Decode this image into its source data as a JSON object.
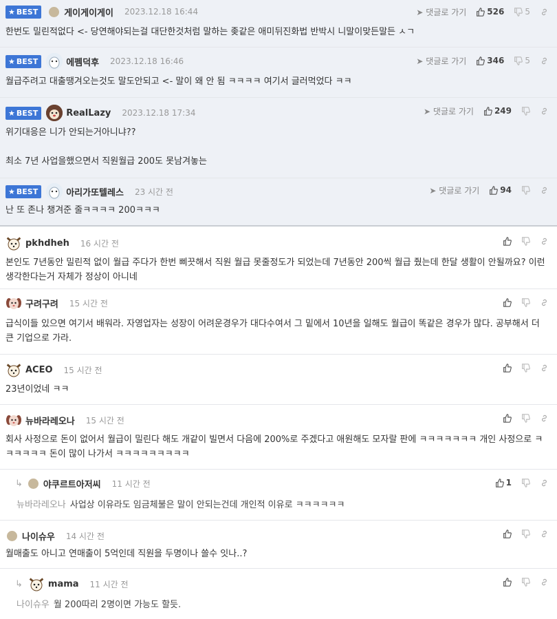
{
  "labels": {
    "best": "BEST",
    "reply_go": "댓글로 가기"
  },
  "comments": [
    {
      "nick": "게이게이게이",
      "time": "2023.12.18 16:44",
      "up": "526",
      "down": "5",
      "text": "한번도 밀린적없다 <- 당연해야되는걸 대단한것처럼 말하는 좆같은 애미뒤진화법 반박시 니말이맞든말든 ㅅㄱ"
    },
    {
      "nick": "에펨덕후",
      "time": "2023.12.18 16:46",
      "up": "346",
      "down": "5",
      "text": "월급주려고 대출땡겨오는것도 말도안되고 <- 말이 왜 안 됨 ㅋㅋㅋㅋ 여기서 글러먹었다 ㅋㅋ"
    },
    {
      "nick": "RealLazy",
      "time": "2023.12.18 17:34",
      "up": "249",
      "down": "",
      "text": "위기대응은 니가 안되는거아니냐??\n\n최소 7년 사업을했으면서 직원월급 200도 못남겨놓는"
    },
    {
      "nick": "아리가또텔레스",
      "time": "23 시간 전",
      "up": "94",
      "down": "",
      "text": "난 또 존나 챙겨준 줄ㅋㅋㅋㅋ 200ㅋㅋㅋ"
    },
    {
      "nick": "pkhdheh",
      "time": "16 시간 전",
      "up": "",
      "text": "본인도 7년동안 밀린적 없이 월급 주다가 한번 삐끗해서 직원 월급 못줄정도가 되었는데 7년동안 200씩 월급 줬는데 한달 생활이 안될까요? 이런 생각한다는거 자체가 정상이 아니네"
    },
    {
      "nick": "구려구려",
      "time": "15 시간 전",
      "up": "",
      "text": "급식이들 있으면 여기서 배워라. 자영업자는 성장이 어려운경우가 대다수여서 그 밑에서 10년을 일해도 월급이 똑같은 경우가 많다. 공부해서 더 큰 기업으로 가라."
    },
    {
      "nick": "ACEO",
      "time": "15 시간 전",
      "up": "",
      "text": "23년이었네 ㅋㅋ"
    },
    {
      "nick": "뉴바라레오나",
      "time": "15 시간 전",
      "up": "",
      "text": "회사 사정으로 돈이 없어서 월급이 밀린다 해도 개같이 빌면서 다음에 200%로 주겠다고 애원해도 모자랄 판에 ㅋㅋㅋㅋㅋㅋㅋ 개인 사정으로 ㅋㅋㅋㅋㅋㅋ 돈이 많이 나가서 ㅋㅋㅋㅋㅋㅋㅋㅋㅋ"
    },
    {
      "nick": "야쿠르트아저씨",
      "time": "11 시간 전",
      "up": "1",
      "to": "뉴바라레오나",
      "text": "사업상 이유라도 임금체불은 말이 안되는건데 개인적 이유로 ㅋㅋㅋㅋㅋㅋ"
    },
    {
      "nick": "나이슈우",
      "time": "14 시간 전",
      "up": "",
      "text": "월매출도 아니고 연매출이 5억인데 직원을 두명이나 쓸수 잇나..?"
    },
    {
      "nick": "mama",
      "time": "11 시간 전",
      "up": "",
      "to": "나이슈우",
      "text": "월 200따리 2명이면 가능도 할듯."
    }
  ]
}
